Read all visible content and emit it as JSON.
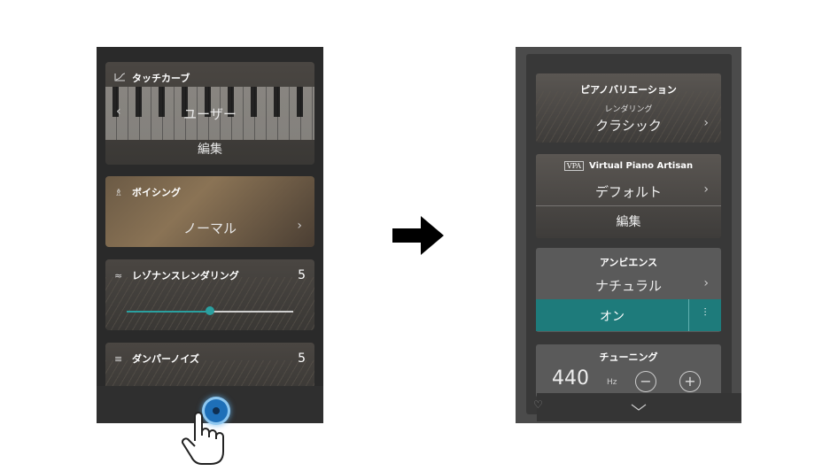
{
  "left": {
    "touch_curve": {
      "label": "タッチカーブ",
      "value": "ユーザー",
      "edit": "編集"
    },
    "voicing": {
      "label": "ボイシング",
      "value": "ノーマル"
    },
    "resonance": {
      "label": "レゾナンスレンダリング",
      "value": "5",
      "slider_fraction": 0.5
    },
    "damper": {
      "label": "ダンパーノイズ",
      "value": "5"
    }
  },
  "right": {
    "piano_variation": {
      "label": "ピアノバリエーション",
      "sub": "レンダリング",
      "value": "クラシック"
    },
    "vpa": {
      "badge": "VPA",
      "label": "Virtual Piano Artisan",
      "value": "デフォルト",
      "edit": "編集"
    },
    "ambience": {
      "label": "アンビエンス",
      "value": "ナチュラル",
      "toggle": "オン"
    },
    "tuning": {
      "label": "チューニング",
      "value": "440",
      "unit": "Hz"
    }
  },
  "colors": {
    "accent": "#1e7b7b",
    "touch": "#1e6fb8"
  },
  "icons": [
    "touch-curve-icon",
    "voicing-icon",
    "resonance-icon",
    "damper-icon",
    "chevron-left-icon",
    "chevron-right-icon",
    "arrow-right-icon",
    "hand-pointer-icon",
    "heart-icon",
    "chevron-down-icon",
    "minus-icon",
    "plus-icon",
    "equalizer-icon"
  ]
}
